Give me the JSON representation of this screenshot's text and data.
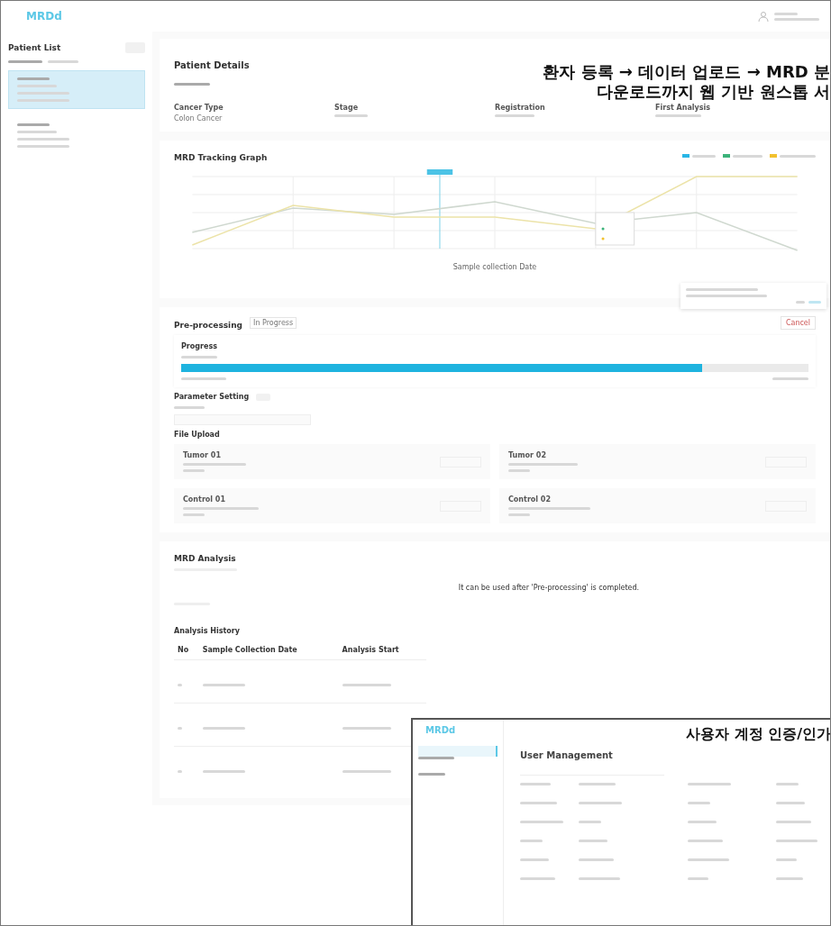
{
  "header": {
    "logo": "MRDd"
  },
  "sidebar": {
    "title": "Patient List",
    "patients": [
      {
        "selected": true
      },
      {
        "selected": false
      }
    ]
  },
  "details": {
    "title": "Patient Details",
    "fields": [
      {
        "label": "Cancer Type",
        "value": "Colon Cancer"
      },
      {
        "label": "Stage"
      },
      {
        "label": "Registration"
      },
      {
        "label": "First Analysis"
      }
    ]
  },
  "graph": {
    "title": "MRD Tracking Graph",
    "xlabel": "Sample collection Date",
    "legend": [
      {
        "color": "#29b6e6"
      },
      {
        "color": "#3cb37a"
      },
      {
        "color": "#f2c12e"
      }
    ]
  },
  "preprocessing": {
    "title": "Pre-processing",
    "status": "In Progress",
    "cancel": "Cancel",
    "progress_title": "Progress",
    "level": 0.83,
    "parameter_title": "Parameter Setting",
    "upload_title": "File Upload",
    "files": [
      {
        "label": "Tumor 01"
      },
      {
        "label": "Tumor 02"
      },
      {
        "label": "Control 01"
      },
      {
        "label": "Control 02"
      }
    ]
  },
  "analysis": {
    "title": "MRD Analysis",
    "notice": "It can be used after 'Pre-processing' is completed.",
    "history_title": "Analysis History",
    "columns": [
      "No",
      "Sample Collection Date",
      "Analysis Start"
    ]
  },
  "inset": {
    "logo": "MRDd",
    "title": "User Management"
  },
  "captions": [
    {
      "lines": [
        "환자 등록 → 데이터 업로드 → MRD 분",
        "다운로드까지 웹 기반 원스톱 서"
      ]
    },
    {
      "lines": [
        "사용자 계정 인증/인가"
      ]
    }
  ]
}
